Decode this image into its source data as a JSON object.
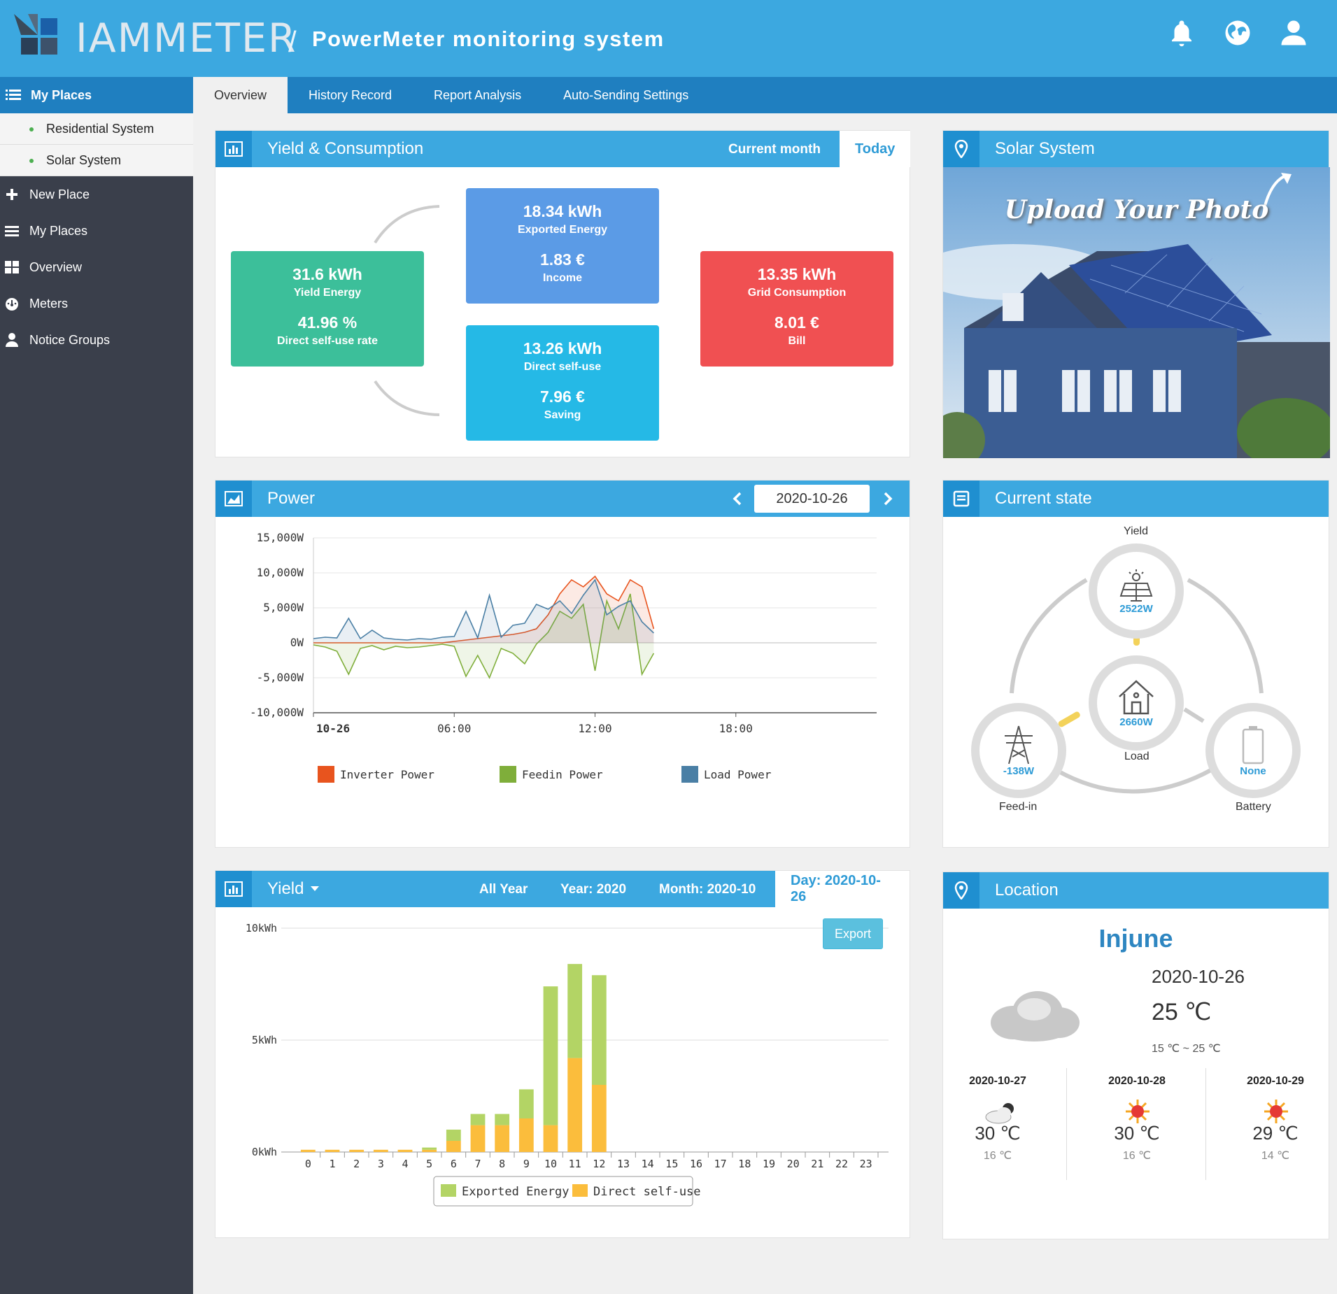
{
  "header": {
    "brand": "IAMMETER",
    "separator": "/",
    "title": "PowerMeter monitoring system"
  },
  "sidebar": {
    "section": "My Places",
    "places": [
      "Residential System",
      "Solar System"
    ],
    "items": [
      {
        "label": "New Place",
        "icon": "plus-icon"
      },
      {
        "label": "My Places",
        "icon": "list-icon"
      },
      {
        "label": "Overview",
        "icon": "grid-icon"
      },
      {
        "label": "Meters",
        "icon": "dashboard-icon"
      },
      {
        "label": "Notice Groups",
        "icon": "user-icon"
      }
    ]
  },
  "tabs": [
    "Overview",
    "History Record",
    "Report Analysis",
    "Auto-Sending Settings"
  ],
  "yield_consumption": {
    "title": "Yield & Consumption",
    "period_month": "Current month",
    "period_today": "Today",
    "yield": {
      "value": "31.6 kWh",
      "label": "Yield Energy",
      "value2": "41.96 %",
      "label2": "Direct self-use rate"
    },
    "exported": {
      "value": "18.34 kWh",
      "label": "Exported Energy",
      "value2": "1.83 €",
      "label2": "Income"
    },
    "selfuse": {
      "value": "13.26 kWh",
      "label": "Direct self-use",
      "value2": "7.96 €",
      "label2": "Saving"
    },
    "grid": {
      "value": "13.35 kWh",
      "label": "Grid Consumption",
      "value2": "8.01 €",
      "label2": "Bill"
    }
  },
  "solar_system": {
    "title": "Solar System",
    "upload_text": "Upload Your Photo"
  },
  "power": {
    "title": "Power",
    "date": "2020-10-26"
  },
  "current_state": {
    "title": "Current state",
    "yield_label": "Yield",
    "yield_w": "2522W",
    "load_label": "Load",
    "load_w": "2660W",
    "feedin_label": "Feed-in",
    "feedin_w": "-138W",
    "battery_label": "Battery",
    "battery_w": "None"
  },
  "yield_panel": {
    "title": "Yield",
    "all_year": "All Year",
    "year": "Year: 2020",
    "month": "Month: 2020-10",
    "day": "Day: 2020-10-26",
    "export": "Export"
  },
  "location": {
    "title": "Location",
    "city": "Injune",
    "date": "2020-10-26",
    "temp": "25 ℃",
    "range": "15 ℃ ~ 25 ℃",
    "forecast": [
      {
        "date": "2020-10-27",
        "high": "30 ℃",
        "low": "16 ℃",
        "icon": "cloud-sun-icon"
      },
      {
        "date": "2020-10-28",
        "high": "30 ℃",
        "low": "16 ℃",
        "icon": "sun-icon"
      },
      {
        "date": "2020-10-29",
        "high": "29 ℃",
        "low": "14 ℃",
        "icon": "sun-icon"
      }
    ]
  },
  "colors": {
    "accent": "#3ca8e0",
    "dark_accent": "#1f7fc0",
    "sidebar": "#3a3f4b",
    "yield_green": "#3cbf9a",
    "exported_blue": "#5b9be6",
    "selfuse_cyan": "#25b9e6",
    "grid_red": "#f05052",
    "inverter": "#e8541e",
    "feedin": "#7fae3a",
    "load": "#4a7fa5",
    "exported_bar": "#b3d465",
    "selfuse_bar": "#fbbd3c"
  },
  "chart_data": [
    {
      "type": "line",
      "ylim": [
        -10000,
        15000
      ],
      "yticks": [
        "15,000W",
        "10,000W",
        "5,000W",
        "0W",
        "-5,000W",
        "-10,000W"
      ],
      "xticks": [
        "10-26",
        "06:00",
        "12:00",
        "18:00"
      ],
      "x_hours": [
        0,
        0.5,
        1,
        1.5,
        2,
        2.5,
        3,
        3.5,
        4,
        4.5,
        5,
        5.5,
        6,
        6.5,
        7,
        7.5,
        8,
        8.5,
        9,
        9.5,
        10,
        10.5,
        11,
        11.5,
        12,
        12.5,
        13,
        13.5,
        14,
        14.5
      ],
      "series": [
        {
          "name": "Inverter Power",
          "values": [
            0,
            0,
            0,
            0,
            0,
            0,
            0,
            0,
            0,
            0,
            0,
            0,
            200,
            400,
            600,
            800,
            1000,
            1200,
            1500,
            2000,
            4000,
            7000,
            9000,
            8000,
            9500,
            7000,
            6000,
            9000,
            8000,
            2000
          ]
        },
        {
          "name": "Feedin Power",
          "values": [
            -300,
            -600,
            -1200,
            -4500,
            -800,
            -400,
            -1000,
            -500,
            -700,
            -600,
            -400,
            -200,
            -500,
            -4800,
            -1800,
            -5000,
            -800,
            -1500,
            -3000,
            -200,
            1500,
            4500,
            3500,
            5500,
            -4000,
            6000,
            2000,
            7000,
            -4500,
            -1500
          ]
        },
        {
          "name": "Load Power",
          "values": [
            600,
            800,
            700,
            3500,
            600,
            1800,
            700,
            500,
            400,
            600,
            500,
            800,
            900,
            4500,
            700,
            6800,
            800,
            2500,
            2800,
            5500,
            4800,
            6000,
            4200,
            6800,
            9000,
            4000,
            5200,
            6000,
            3000,
            1400
          ]
        }
      ]
    },
    {
      "type": "bar",
      "ylim": [
        0,
        10
      ],
      "yticks": [
        "10kWh",
        "5kWh",
        "0kWh"
      ],
      "categories": [
        "0",
        "1",
        "2",
        "3",
        "4",
        "5",
        "6",
        "7",
        "8",
        "9",
        "10",
        "11",
        "12",
        "13",
        "14",
        "15",
        "16",
        "17",
        "18",
        "19",
        "20",
        "21",
        "22",
        "23"
      ],
      "series": [
        {
          "name": "Direct self-use",
          "values": [
            0.1,
            0.1,
            0.1,
            0.1,
            0.1,
            0.1,
            0.5,
            1.2,
            1.2,
            1.5,
            1.2,
            4.2,
            3.0,
            0,
            0,
            0,
            0,
            0,
            0,
            0,
            0,
            0,
            0,
            0
          ]
        },
        {
          "name": "Exported Energy",
          "values": [
            0,
            0,
            0,
            0,
            0,
            0.1,
            0.5,
            0.5,
            0.5,
            1.3,
            6.2,
            4.2,
            4.9,
            0,
            0,
            0,
            0,
            0,
            0,
            0,
            0,
            0,
            0,
            0
          ]
        }
      ]
    }
  ]
}
